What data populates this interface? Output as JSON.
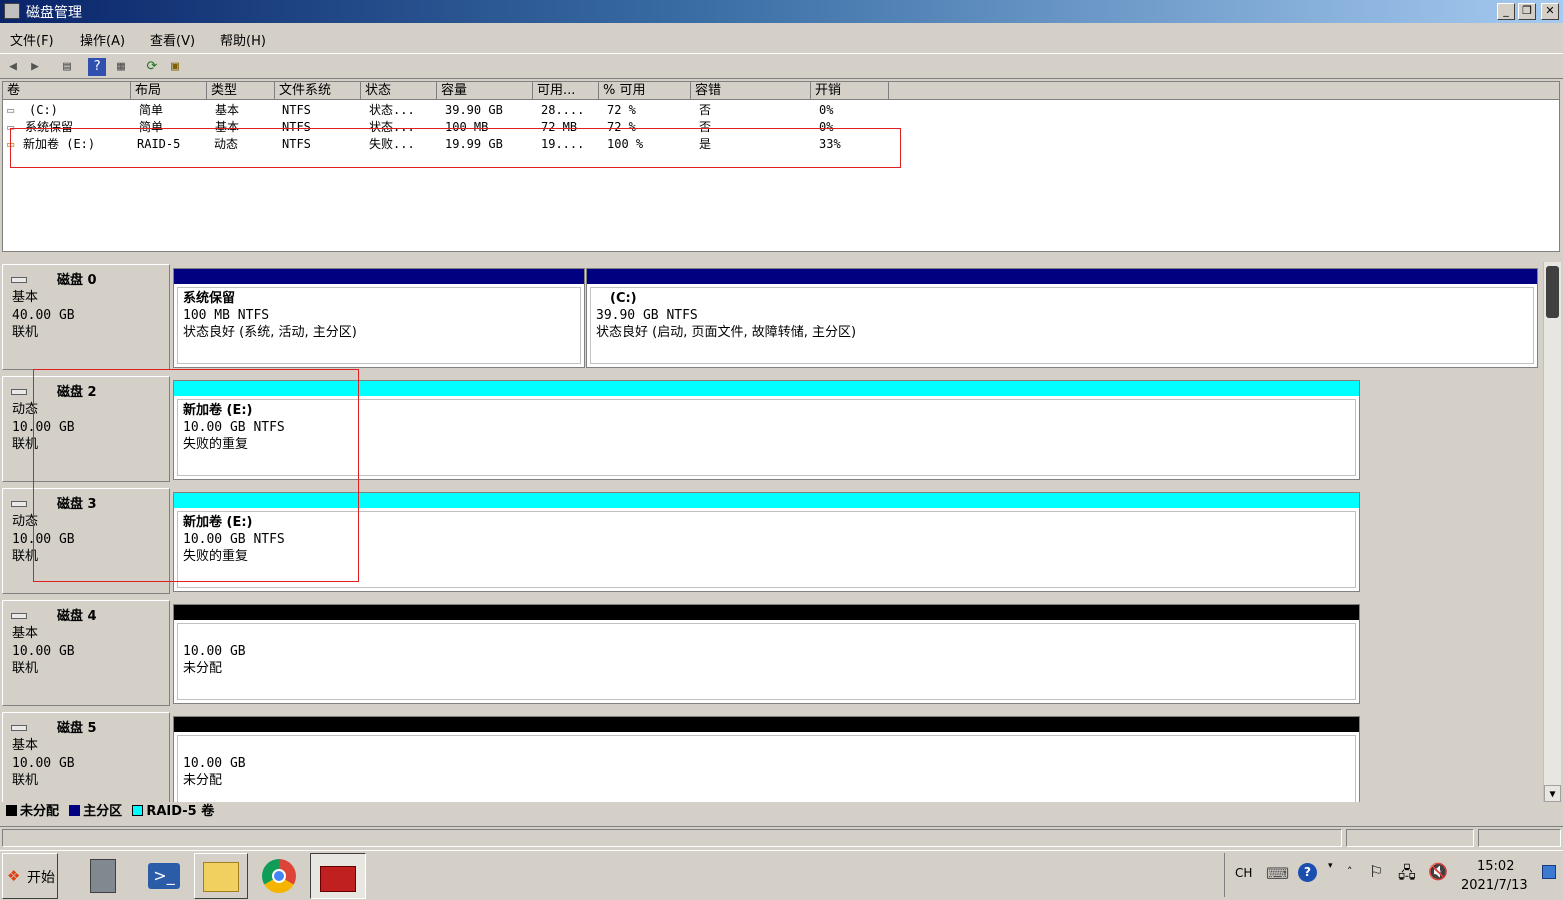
{
  "window": {
    "title": "磁盘管理"
  },
  "menu": [
    "文件(F)",
    "操作(A)",
    "查看(V)",
    "帮助(H)"
  ],
  "columns": [
    "卷",
    "布局",
    "类型",
    "文件系统",
    "状态",
    "容量",
    "可用...",
    "% 可用",
    "容错",
    "开销"
  ],
  "volumes": [
    {
      "name": "(C:)",
      "layout": "简单",
      "type": "基本",
      "fs": "NTFS",
      "status": "状态...",
      "capacity": "39.90 GB",
      "free": "28....",
      "pct": "72 %",
      "fault": "否",
      "overhead": "0%"
    },
    {
      "name": "系统保留",
      "layout": "简单",
      "type": "基本",
      "fs": "NTFS",
      "status": "状态...",
      "capacity": "100 MB",
      "free": "72 MB",
      "pct": "72 %",
      "fault": "否",
      "overhead": "0%"
    },
    {
      "name": "新加卷 (E:)",
      "layout": "RAID-5",
      "type": "动态",
      "fs": "NTFS",
      "status": "失败...",
      "capacity": "19.99 GB",
      "free": "19....",
      "pct": "100 %",
      "fault": "是",
      "overhead": "33%"
    }
  ],
  "disks": [
    {
      "title": "磁盘 0",
      "kind": "基本",
      "size": "40.00 GB",
      "state": "联机",
      "parts": [
        {
          "name": "系统保留",
          "line2": "100 MB NTFS",
          "line3": "状态良好 (系统, 活动, 主分区)",
          "color": "#000080"
        },
        {
          "name": "(C:)",
          "line2": "39.90 GB NTFS",
          "line3": "状态良好 (启动, 页面文件, 故障转储, 主分区)",
          "color": "#000080"
        }
      ]
    },
    {
      "title": "磁盘 2",
      "kind": "动态",
      "size": "10.00 GB",
      "state": "联机",
      "parts": [
        {
          "name": "新加卷  (E:)",
          "line2": "10.00 GB NTFS",
          "line3": "失败的重复",
          "color": "#00ffff"
        }
      ]
    },
    {
      "title": "磁盘 3",
      "kind": "动态",
      "size": "10.00 GB",
      "state": "联机",
      "parts": [
        {
          "name": "新加卷  (E:)",
          "line2": "10.00 GB NTFS",
          "line3": "失败的重复",
          "color": "#00ffff"
        }
      ]
    },
    {
      "title": "磁盘 4",
      "kind": "基本",
      "size": "10.00 GB",
      "state": "联机",
      "parts": [
        {
          "name": "",
          "line2": "10.00 GB",
          "line3": "未分配",
          "color": "#000000"
        }
      ]
    },
    {
      "title": "磁盘 5",
      "kind": "基本",
      "size": "10.00 GB",
      "state": "联机",
      "parts": [
        {
          "name": "",
          "line2": "10.00 GB",
          "line3": "未分配",
          "color": "#000000"
        }
      ]
    }
  ],
  "legend": [
    {
      "label": "未分配",
      "color": "#000000"
    },
    {
      "label": "主分区",
      "color": "#000080"
    },
    {
      "label": "RAID-5 卷",
      "color": "#00ffff"
    }
  ],
  "taskbar": {
    "start_label": "开始",
    "lang": "CH",
    "time": "15:02",
    "date": "2021/7/13"
  }
}
